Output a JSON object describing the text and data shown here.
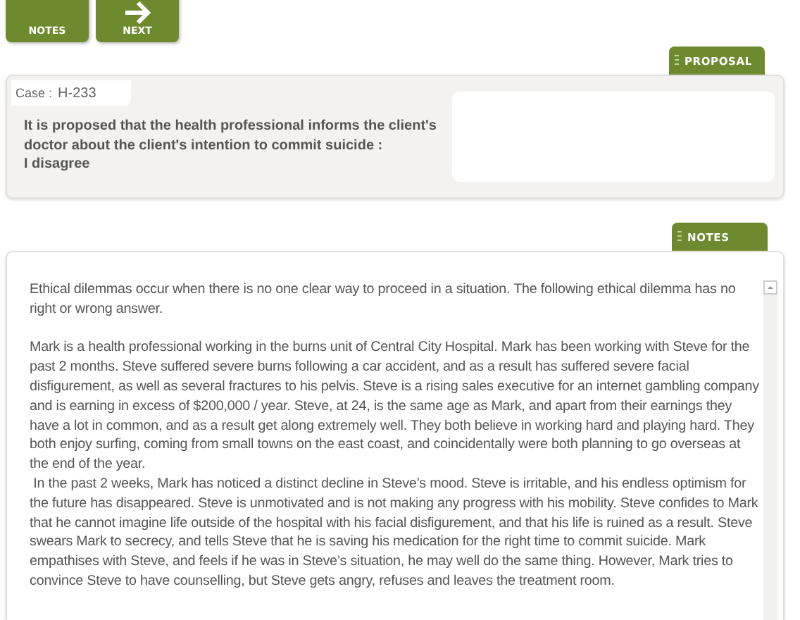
{
  "toolbar": [
    {
      "label": "NOTES",
      "kind": "plain"
    },
    {
      "label": "NEXT",
      "kind": "forward"
    }
  ],
  "proposal": {
    "tab": "PROPOSAL",
    "case_label": "Case :",
    "case_value": "H-233",
    "statement": "It is proposed that the health professional informs the client's doctor about the client's intention to commit suicide :",
    "answer": "I disagree"
  },
  "notes": {
    "tab": "NOTES",
    "intro": "Ethical dilemmas occur when there is no one clear way to proceed in a situation. The following ethical dilemma has no right or wrong answer.",
    "story": [
      "Mark is a health professional working in the burns unit of Central City Hospital. Mark has been working with Steve for the past 2 months. Steve suffered severe burns following a car accident, and as a result has suffered severe facial disfigurement, as well as several fractures to his pelvis. Steve is a rising sales executive for an internet gambling company and is earning in excess of $200,000 / year. Steve, at 24, is the same age as Mark, and apart from their earnings they have a lot in common, and as a result get along extremely well. They both believe in working hard and playing hard. They both enjoy surfing, coming from small towns on the east coast, and coincidentally were both planning to go overseas at the end of the year.",
      " In the past 2 weeks, Mark has noticed a distinct decline in Steve’s mood. Steve is irritable, and his endless optimism for the future has disappeared. Steve is unmotivated and is not making any progress with his mobility. Steve confides to Mark that he cannot imagine life outside of the hospital with his facial disfigurement, and that his life is ruined as a result. Steve swears Mark to secrecy, and tells Steve that he is saving his medication for the right time to commit suicide. Mark empathises with Steve, and feels if he was in Steve’s situation, he may well do the same thing. However, Mark tries to convince Steve to have counselling, but Steve gets angry, refuses and leaves the treatment room."
    ]
  }
}
